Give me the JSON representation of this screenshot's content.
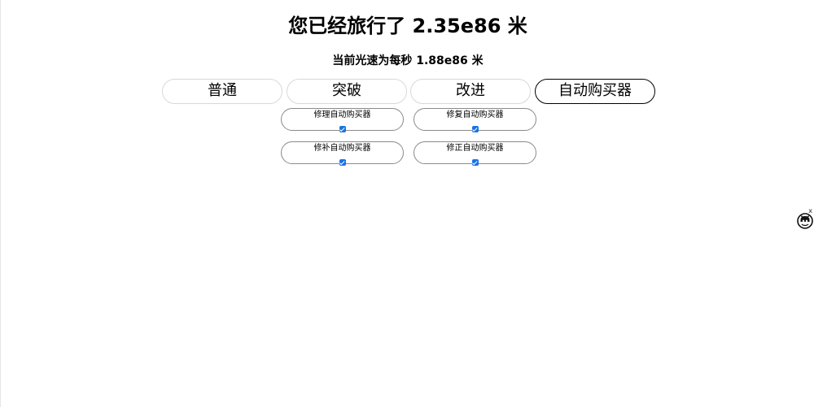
{
  "header": {
    "title": "您已经旅行了 2.35e86 米",
    "subtitle": "当前光速为每秒 1.88e86 米"
  },
  "tabs": [
    {
      "label": "普通",
      "active": false
    },
    {
      "label": "突破",
      "active": false
    },
    {
      "label": "改进",
      "active": false
    },
    {
      "label": "自动购买器",
      "active": true
    }
  ],
  "autobuyers": [
    {
      "label": "修理自动购买器",
      "checked": true
    },
    {
      "label": "修复自动购买器",
      "checked": true
    },
    {
      "label": "修补自动购买器",
      "checked": true
    },
    {
      "label": "修正自动购买器",
      "checked": true
    }
  ],
  "widget": {
    "close_label": "x",
    "icon": "octocat-icon"
  },
  "colors": {
    "checkbox": "#1a73e8",
    "active_tab_border": "#000000",
    "tab_border": "#d8d8d8"
  }
}
